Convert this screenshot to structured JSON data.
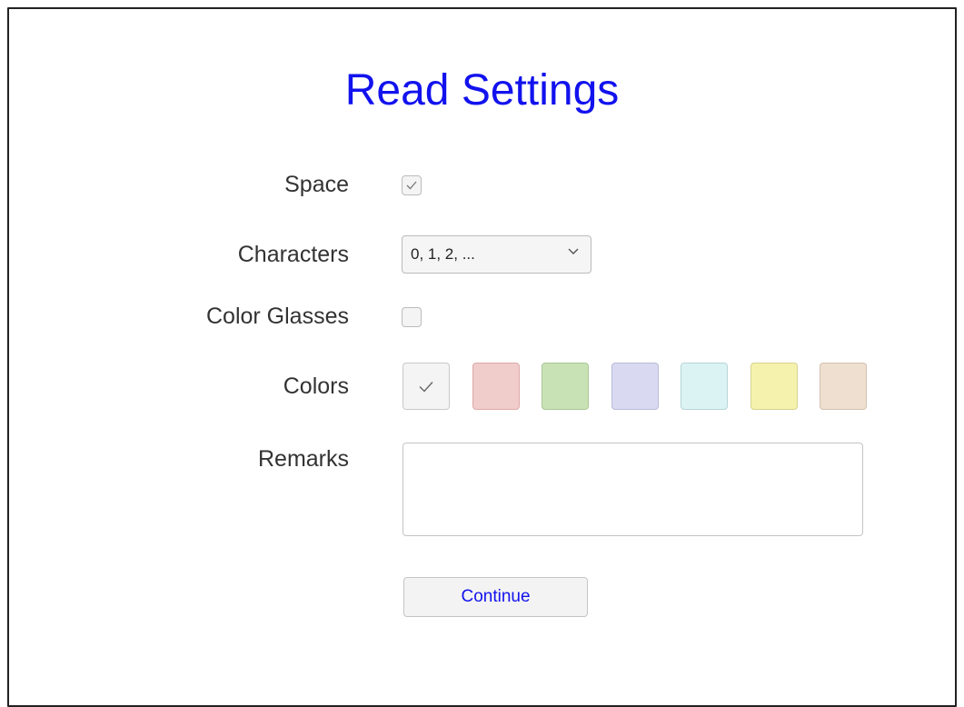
{
  "page": {
    "title": "Read Settings"
  },
  "form": {
    "space": {
      "label": "Space",
      "checked": true
    },
    "characters": {
      "label": "Characters",
      "selected": "0, 1, 2, ..."
    },
    "color_glasses": {
      "label": "Color Glasses",
      "checked": false
    },
    "colors": {
      "label": "Colors",
      "swatches": [
        {
          "color": "#f4f4f4",
          "border": "#c8c8c8",
          "selected": true
        },
        {
          "color": "#f0cccb",
          "border": "#ddaaa9",
          "selected": false
        },
        {
          "color": "#c9e2b5",
          "border": "#a9c796",
          "selected": false
        },
        {
          "color": "#d9daf1",
          "border": "#b9bbd9",
          "selected": false
        },
        {
          "color": "#dcf3f4",
          "border": "#b6d5d7",
          "selected": false
        },
        {
          "color": "#f5f2ad",
          "border": "#d6d38e",
          "selected": false
        },
        {
          "color": "#eedfd0",
          "border": "#d4c1ae",
          "selected": false
        }
      ]
    },
    "remarks": {
      "label": "Remarks",
      "value": "",
      "placeholder": ""
    },
    "continue_label": "Continue"
  },
  "colors": {
    "accent": "#1212ee",
    "label_text": "#333333"
  }
}
